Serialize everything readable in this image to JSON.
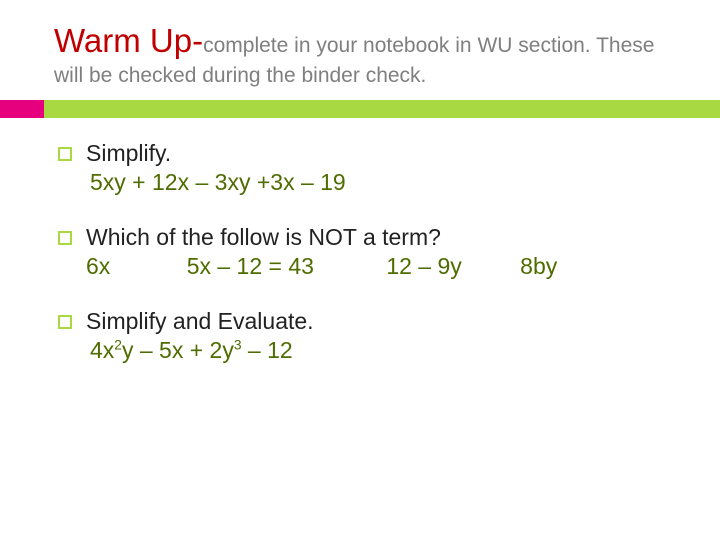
{
  "header": {
    "titleMain": "Warm Up",
    "dash": "-",
    "sub1": "complete in your notebook in WU section. These",
    "sub2": "will be checked during the binder check."
  },
  "q1": {
    "prompt": "Simplify.",
    "expr": "5xy + 12x – 3xy +3x – 19"
  },
  "q2": {
    "prompt": " Which of the follow is NOT a term?",
    "opts": {
      "a": "6x",
      "b": "5x – 12 = 43",
      "c": "12 – 9y",
      "d": "8by"
    }
  },
  "q3": {
    "prompt": "Simplify and Evaluate.",
    "exprParts": {
      "p1": "4x",
      "s1": "2",
      "p2": "y – 5x + 2y",
      "s2": "3",
      "p3": " – 12"
    }
  }
}
